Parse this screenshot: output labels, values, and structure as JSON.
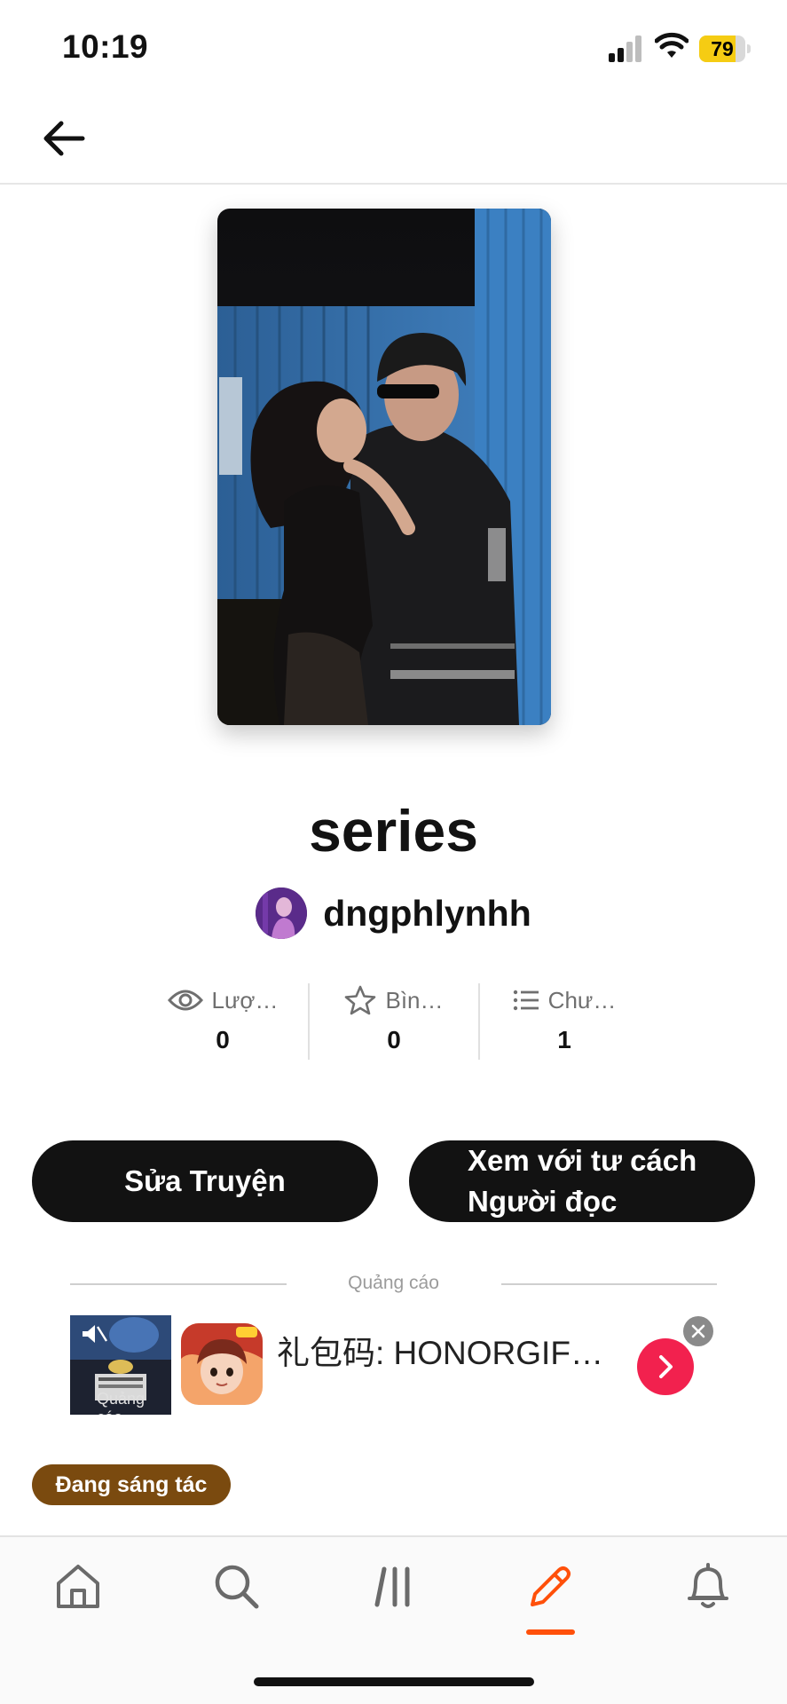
{
  "status_bar": {
    "time": "10:19",
    "battery_percent": 79,
    "battery_label": "79",
    "signal_bars_active": 2,
    "signal_bars_total": 4,
    "battery_color": "#f5cc13"
  },
  "header": {
    "back_icon": "arrow-left-icon"
  },
  "story": {
    "title": "series",
    "author": "dngphlynhh",
    "cover_icon": "cover-photo"
  },
  "stats": [
    {
      "icon": "eye-icon",
      "label": "Lượ…",
      "value": "0"
    },
    {
      "icon": "star-icon",
      "label": "Bìn…",
      "value": "0"
    },
    {
      "icon": "list-icon",
      "label": "Chư…",
      "value": "1"
    }
  ],
  "actions": {
    "edit_label": "Sửa Truyện",
    "view_as_reader_line1": "Xem với tư cách",
    "view_as_reader_line2": "Người đọc"
  },
  "ad": {
    "section_label": "Quảng cáo",
    "thumbnail_caption": "Quảng cáo",
    "headline": "礼包码: HONORGIFT….",
    "cta_icon": "chevron-right-icon",
    "close_label": "X",
    "cta_color": "#f2214e"
  },
  "story_status": {
    "label": "Đang sáng tác",
    "color": "#7a4a0f"
  },
  "tab_bar": {
    "tabs": [
      {
        "name": "home",
        "icon": "home-icon"
      },
      {
        "name": "search",
        "icon": "search-icon"
      },
      {
        "name": "library",
        "icon": "library-icon"
      },
      {
        "name": "write",
        "icon": "pencil-icon",
        "active": true
      },
      {
        "name": "notifications",
        "icon": "bell-icon"
      }
    ],
    "active_color": "#ff500a"
  }
}
